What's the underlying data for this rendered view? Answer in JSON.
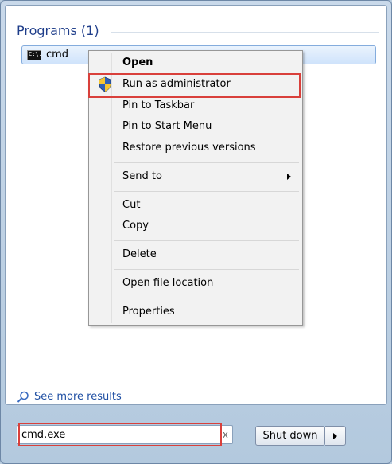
{
  "results": {
    "group_header": "Programs (1)",
    "items": [
      {
        "label": "cmd",
        "icon": "command-prompt-icon",
        "icon_text": "C:\\."
      }
    ]
  },
  "context_menu": {
    "items": [
      {
        "label": "Open",
        "bold": true
      },
      {
        "label": "Run as administrator",
        "icon": "uac-shield-icon",
        "highlighted": true
      },
      {
        "label": "Pin to Taskbar"
      },
      {
        "label": "Pin to Start Menu"
      },
      {
        "label": "Restore previous versions"
      },
      {
        "label": "Send to",
        "submenu": true
      },
      {
        "label": "Cut"
      },
      {
        "label": "Copy"
      },
      {
        "label": "Delete"
      },
      {
        "label": "Open file location"
      },
      {
        "label": "Properties"
      }
    ]
  },
  "footer": {
    "see_more_label": "See more results",
    "search_value": "cmd.exe",
    "clear_glyph": "x",
    "shutdown_label": "Shut down"
  },
  "colors": {
    "highlight_outline": "#d9403b",
    "link": "#1f4fa3",
    "group_header": "#1e3d8a"
  }
}
